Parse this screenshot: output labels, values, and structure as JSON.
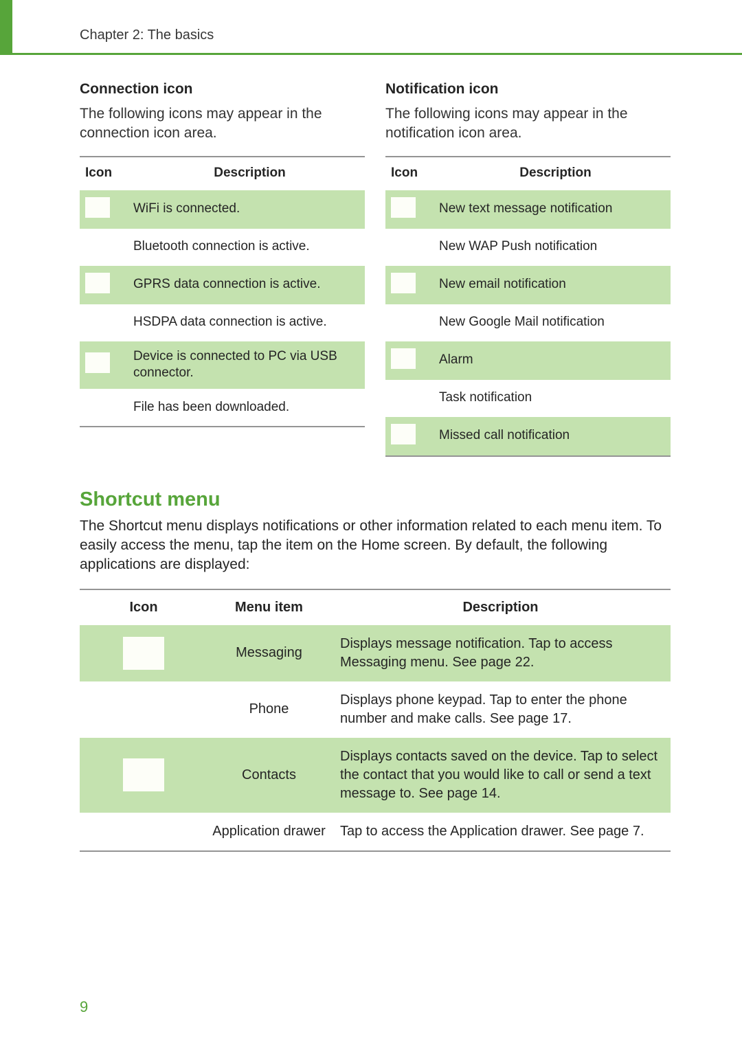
{
  "header": {
    "chapter": "Chapter 2: The basics"
  },
  "left": {
    "heading": "Connection icon",
    "intro": "The following icons may appear in the connection icon area.",
    "th_icon": "Icon",
    "th_desc": "Description",
    "rows": [
      {
        "desc": "WiFi is connected."
      },
      {
        "desc": "Bluetooth connection is active."
      },
      {
        "desc": "GPRS data connection is active."
      },
      {
        "desc": "HSDPA data connection is active."
      },
      {
        "desc": "Device is connected to PC via USB connector."
      },
      {
        "desc": "File has been downloaded."
      }
    ]
  },
  "right": {
    "heading": "Notification icon",
    "intro": "The following icons may appear in the notification icon area.",
    "th_icon": "Icon",
    "th_desc": "Description",
    "rows": [
      {
        "desc": "New text message notification"
      },
      {
        "desc": "New WAP Push notification"
      },
      {
        "desc": "New email notification"
      },
      {
        "desc": "New Google Mail notification"
      },
      {
        "desc": "Alarm"
      },
      {
        "desc": "Task notification"
      },
      {
        "desc": "Missed call notification"
      }
    ]
  },
  "shortcut": {
    "heading": "Shortcut menu",
    "body": "The Shortcut menu displays notifications or other information related to each menu item. To easily access the menu, tap the item on the Home screen. By default, the following applications are displayed:",
    "th_icon": "Icon",
    "th_menu": "Menu item",
    "th_desc": "Description",
    "rows": [
      {
        "menu": "Messaging",
        "desc": "Displays message notification. Tap to access Messaging menu. See page 22."
      },
      {
        "menu": "Phone",
        "desc": "Displays phone keypad. Tap to enter the phone number and make calls. See page 17."
      },
      {
        "menu": "Contacts",
        "desc": "Displays contacts saved on the device. Tap to select the contact that you would like to call or send a text message to. See page 14."
      },
      {
        "menu": "Application drawer",
        "desc": "Tap to access the Application drawer. See page 7."
      }
    ]
  },
  "page_number": "9"
}
